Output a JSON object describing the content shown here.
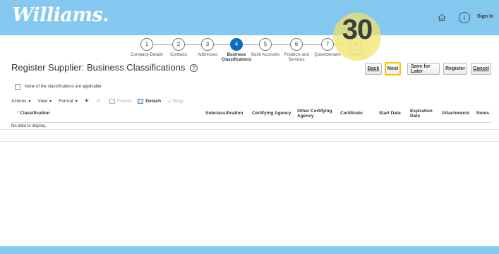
{
  "header": {
    "logo": "Williams.",
    "sign_in": "Sign In",
    "home_icon": "home-icon",
    "info_icon": "info-icon"
  },
  "train": {
    "stops": [
      {
        "num": "1",
        "label": "Company Details",
        "state": "visited"
      },
      {
        "num": "2",
        "label": "Contacts",
        "state": "visited"
      },
      {
        "num": "3",
        "label": "Addresses",
        "state": "visited"
      },
      {
        "num": "4",
        "label": "Business Classifications",
        "state": "current"
      },
      {
        "num": "5",
        "label": "Bank Accounts",
        "state": "unvisited"
      },
      {
        "num": "6",
        "label": "Products and Services",
        "state": "unvisited"
      },
      {
        "num": "7",
        "label": "Questionnaire",
        "state": "unvisited"
      },
      {
        "num": "8",
        "label": "Review",
        "state": "disabled"
      }
    ],
    "step_badge": "30"
  },
  "page": {
    "title": "Register Supplier: Business Classifications",
    "help_icon": "?"
  },
  "buttons": {
    "back": "Back",
    "next": "Next",
    "save_for_later": "Save for Later",
    "register": "Register",
    "cancel": "Cancel"
  },
  "checkbox": {
    "label": "None of the classifications are applicable",
    "checked": false
  },
  "toolbar": {
    "actions": "Actions",
    "view": "View",
    "format": "Format",
    "freeze": "Freeze",
    "detach": "Detach",
    "wrap": "Wrap"
  },
  "table": {
    "required_marker": "*",
    "columns": {
      "classification": "Classification",
      "subclassification": "Subclassification",
      "certifying_agency": "Certifying Agency",
      "other_certifying_agency": "Other Certifying Agency",
      "certificate": "Certificate",
      "start_date": "Start Date",
      "expiration_date": "Expiration Date",
      "attachments": "Attachments",
      "notes": "Notes"
    },
    "empty_text": "No data to display."
  },
  "colors": {
    "header_bg": "#84c8f0",
    "active_step": "#0a6cbf",
    "highlight": "#f3c600"
  }
}
